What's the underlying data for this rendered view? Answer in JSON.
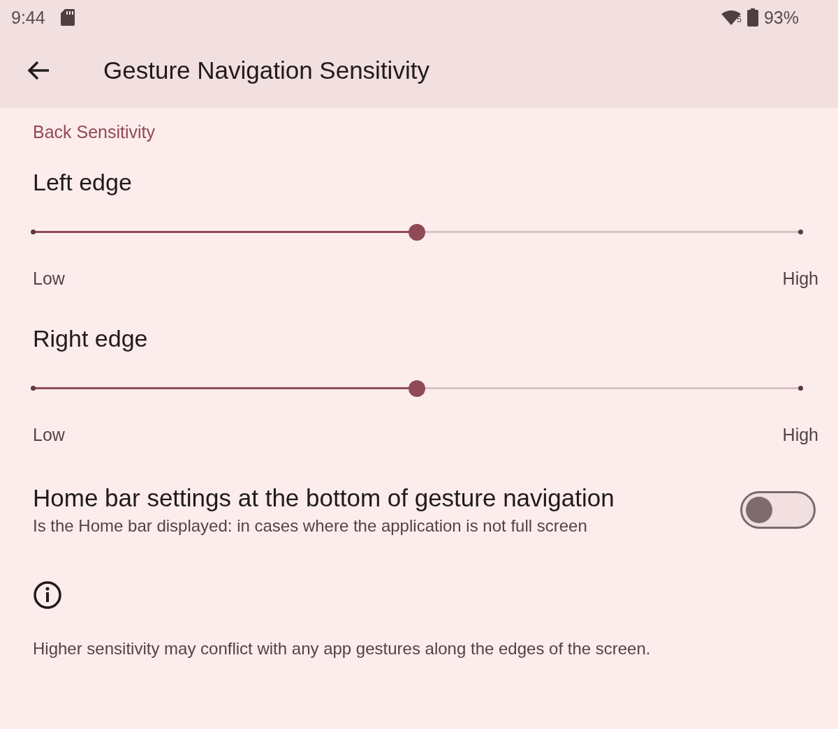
{
  "status_bar": {
    "time": "9:44",
    "network_badge": "5",
    "battery": "93%"
  },
  "app_bar": {
    "title": "Gesture Navigation Sensitivity"
  },
  "section": {
    "title": "Back Sensitivity"
  },
  "sliders": [
    {
      "label": "Left edge",
      "level": 0.5,
      "min_label": "Low",
      "max_label": "High"
    },
    {
      "label": "Right edge",
      "level": 0.5,
      "min_label": "Low",
      "max_label": "High"
    }
  ],
  "home_bar": {
    "title": "Home bar settings at the bottom of gesture navigation",
    "summary": "Is the Home bar displayed: in cases where the application is not full screen",
    "on": false
  },
  "footer": {
    "text": "Higher sensitivity may conflict with any app gestures along the edges of the screen."
  }
}
